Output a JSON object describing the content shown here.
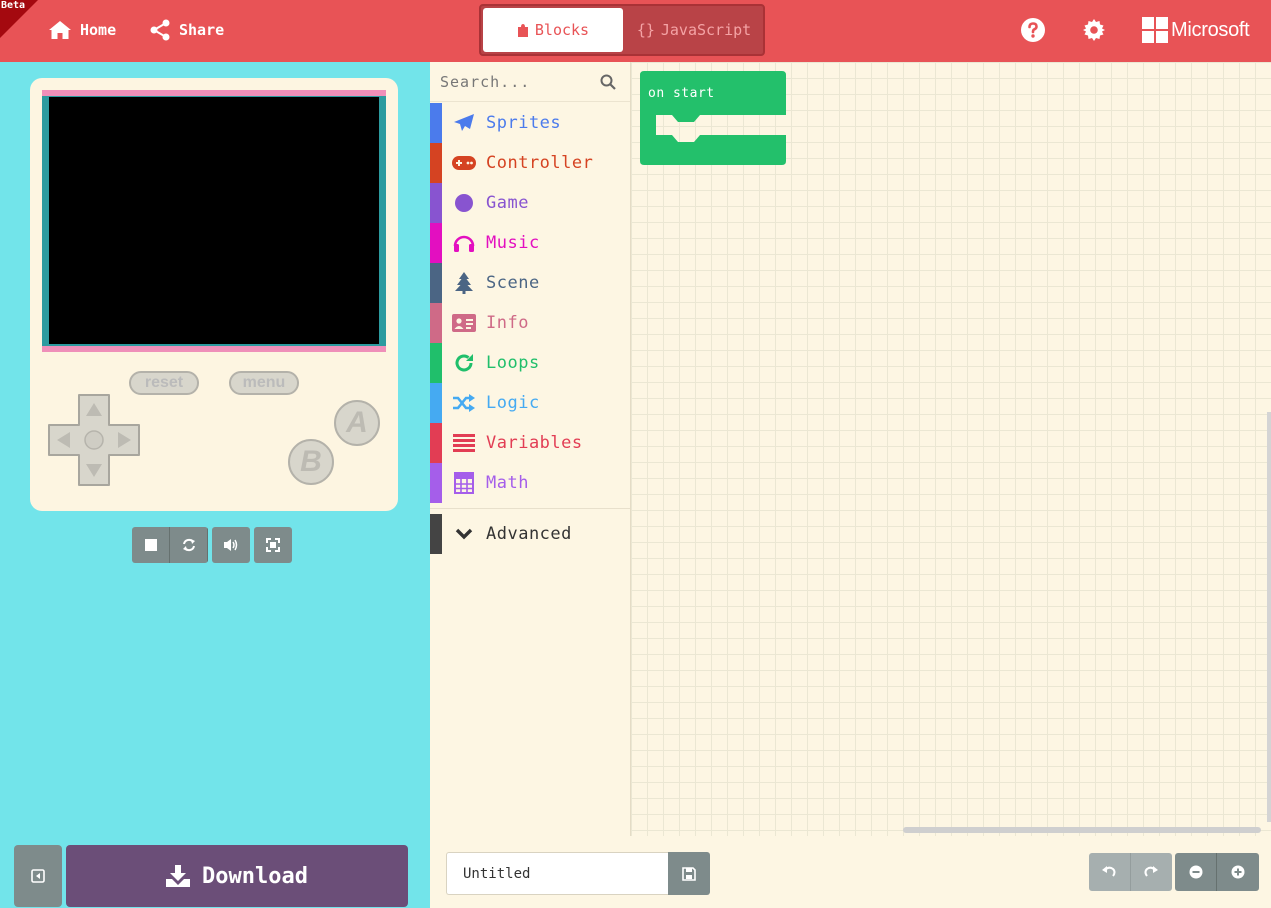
{
  "header": {
    "beta_label": "Beta",
    "home_label": "Home",
    "share_label": "Share",
    "mode_blocks_label": "Blocks",
    "mode_js_brace": "{}",
    "mode_js_label": "JavaScript",
    "brand_label": "Microsoft"
  },
  "simulator": {
    "reset_label": "reset",
    "menu_label": "menu",
    "a_label": "A",
    "b_label": "B",
    "download_label": "Download"
  },
  "toolbox": {
    "search_placeholder": "Search...",
    "categories": [
      {
        "label": "Sprites",
        "color": "#4b7bec",
        "icon": "paper-plane-icon"
      },
      {
        "label": "Controller",
        "color": "#d54322",
        "icon": "gamepad-icon"
      },
      {
        "label": "Game",
        "color": "#8854d0",
        "icon": "circle-icon"
      },
      {
        "label": "Music",
        "color": "#e30fc0",
        "icon": "headphones-icon"
      },
      {
        "label": "Scene",
        "color": "#4b6584",
        "icon": "tree-icon"
      },
      {
        "label": "Info",
        "color": "#cf6a87",
        "icon": "id-card-icon"
      },
      {
        "label": "Loops",
        "color": "#20bf6b",
        "icon": "refresh-icon"
      },
      {
        "label": "Logic",
        "color": "#45aaf2",
        "icon": "shuffle-icon"
      },
      {
        "label": "Variables",
        "color": "#e23d54",
        "icon": "list-icon"
      },
      {
        "label": "Math",
        "color": "#a55eea",
        "icon": "calculator-icon"
      }
    ],
    "advanced_label": "Advanced",
    "advanced_color": "#444444"
  },
  "workspace": {
    "block_label": "on start",
    "block_color": "#23c06b"
  },
  "bottombar": {
    "project_name": "Untitled"
  }
}
